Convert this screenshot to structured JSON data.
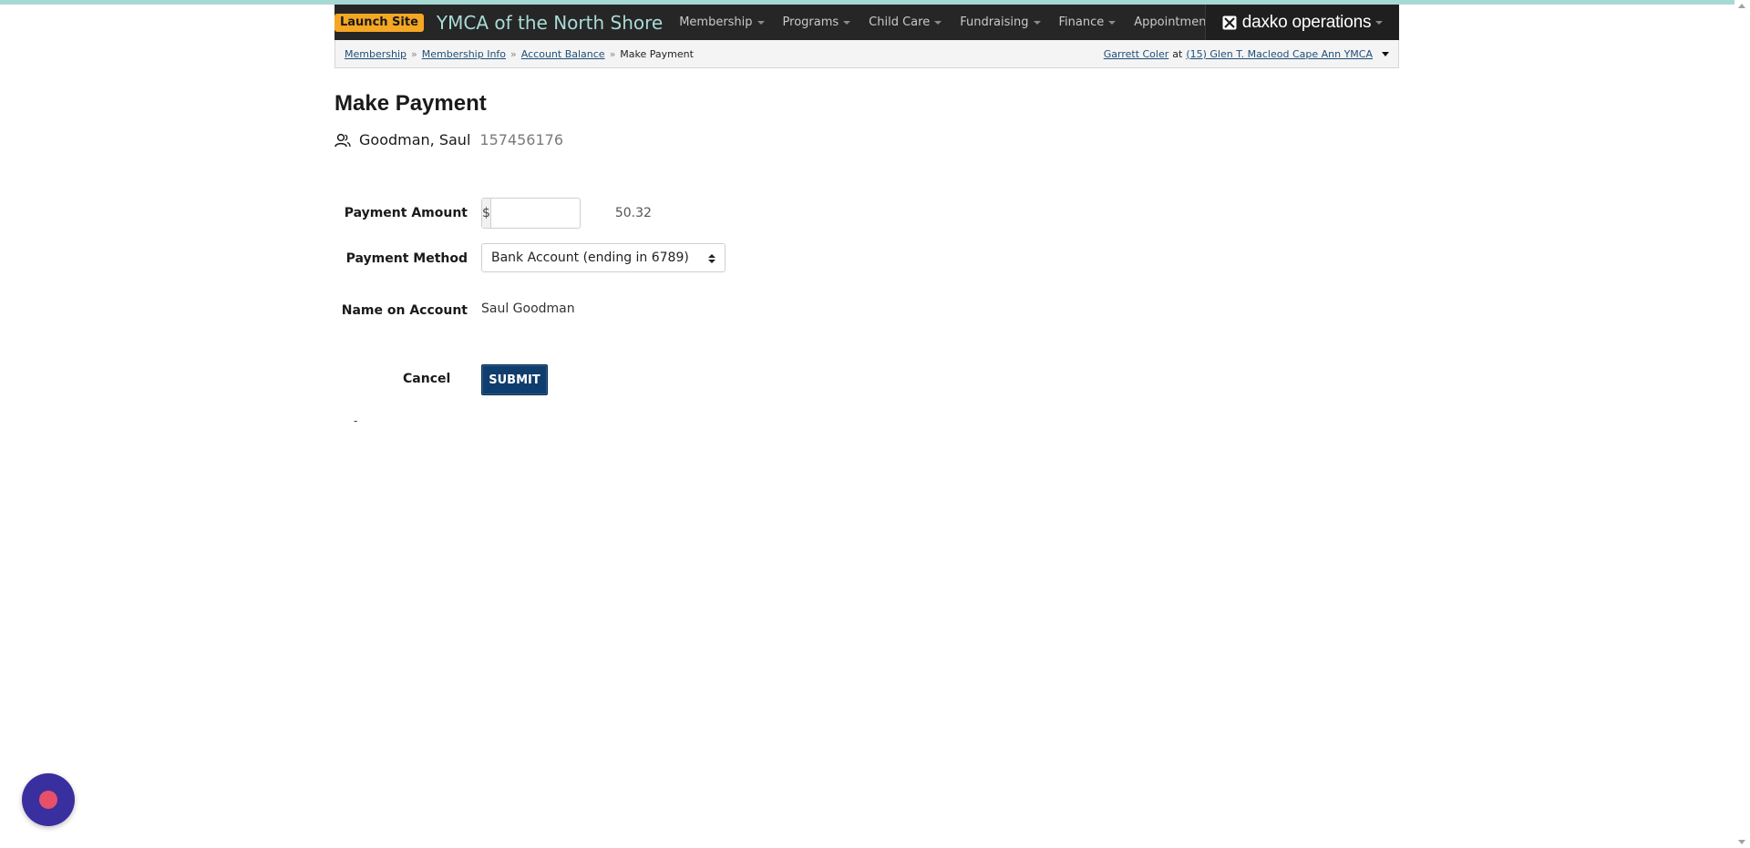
{
  "header": {
    "launch_label": "Launch Site",
    "org_name": "YMCA of the North Shore",
    "menu": [
      {
        "label": "Membership"
      },
      {
        "label": "Programs"
      },
      {
        "label": "Child Care"
      },
      {
        "label": "Fundraising"
      },
      {
        "label": "Finance"
      },
      {
        "label": "Appointments"
      }
    ],
    "product_name": "daxko operations",
    "product_icon": "daxko-logo-icon"
  },
  "breadcrumb": {
    "items": [
      "Membership",
      "Membership Info",
      "Account Balance"
    ],
    "current": "Make Payment",
    "separator": "»"
  },
  "user": {
    "name": "Garrett Coler",
    "at": "at",
    "location": "(15) Glen T. Macleod Cape Ann YMCA"
  },
  "page": {
    "title": "Make Payment"
  },
  "member": {
    "icon": "person-icon",
    "name": "Goodman, Saul",
    "id": "157456176"
  },
  "form": {
    "amount_label": "Payment Amount",
    "currency_symbol": "$",
    "amount_value": "50.32",
    "method_label": "Payment Method",
    "method_value": "Bank Account (ending in 6789)",
    "name_label": "Name on Account",
    "name_value": "Saul Goodman",
    "cancel_label": "Cancel",
    "submit_label": "SUBMIT",
    "footer_dash": "-"
  },
  "colors": {
    "navbar": "#262626",
    "accent_teal": "#a8dcd6",
    "launch_badge": "#f5a623",
    "submit": "#0f3d6e",
    "chat_bubble": "#3a2f9e",
    "chat_dot": "#e8506a"
  }
}
